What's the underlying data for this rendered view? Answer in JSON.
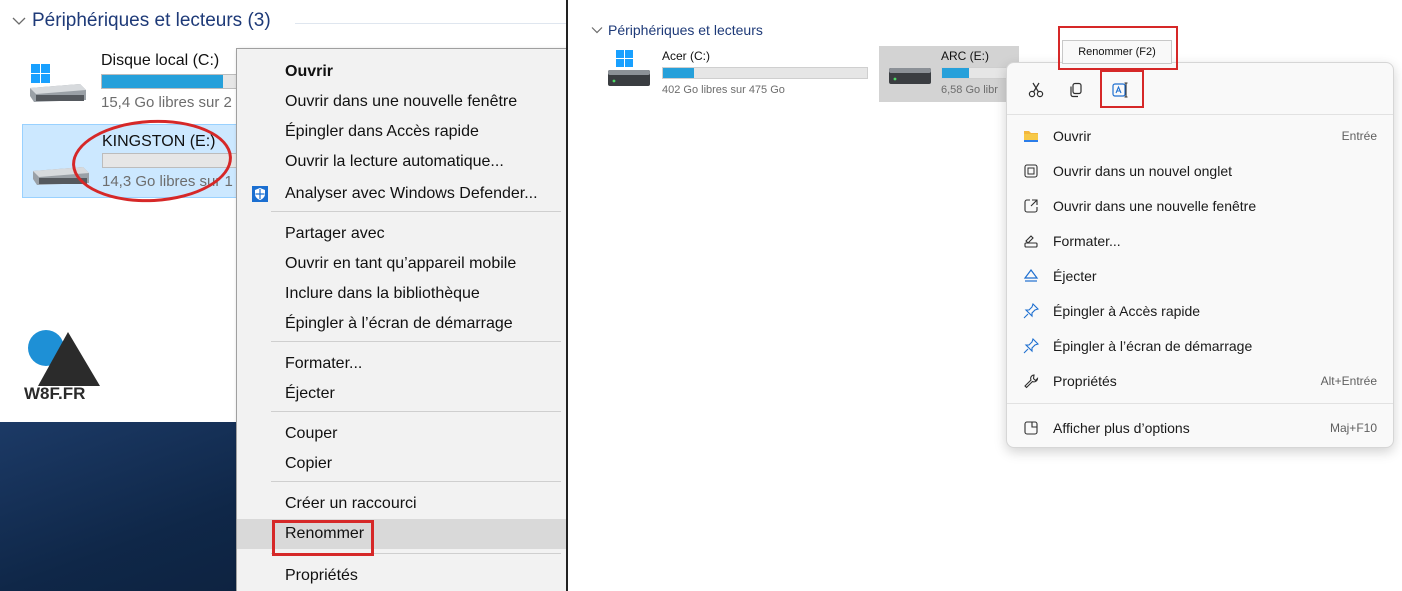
{
  "left": {
    "section_title": "Périphériques et lecteurs (3)",
    "drives": [
      {
        "name": "Disque local (C:)",
        "info": "15,4 Go libres sur 2",
        "usage": 0.58
      },
      {
        "name": "KINGSTON (E:)",
        "info": "14,3 Go libres sur 1",
        "usage": 0.0
      }
    ],
    "logo_text": "W8F.FR",
    "menu": {
      "items": [
        "Ouvrir",
        "Ouvrir dans une nouvelle fenêtre",
        "Épingler dans Accès rapide",
        "Ouvrir la lecture automatique...",
        "Analyser avec Windows Defender...",
        "Partager avec",
        "Ouvrir en tant qu’appareil mobile",
        "Inclure dans la bibliothèque",
        "Épingler à l’écran de démarrage",
        "Formater...",
        "Éjecter",
        "Couper",
        "Copier",
        "Créer un raccourci",
        "Renommer",
        "Propriétés"
      ],
      "highlighted": "Renommer"
    }
  },
  "right": {
    "section_title": "Périphériques et lecteurs",
    "drives": [
      {
        "name": "Acer (C:)",
        "info": "402 Go libres sur 475 Go",
        "usage": 0.15
      },
      {
        "name": "ARC (E:)",
        "info": "6,58 Go libr",
        "usage": 0.35
      }
    ],
    "tooltip": "Renommer (F2)",
    "toolbar_icons": [
      "cut-icon",
      "copy-icon",
      "rename-icon"
    ],
    "menu": {
      "items": [
        {
          "label": "Ouvrir",
          "shortcut": "Entrée",
          "icon": "folder-icon"
        },
        {
          "label": "Ouvrir dans un nouvel onglet",
          "shortcut": "",
          "icon": "new-tab-icon"
        },
        {
          "label": "Ouvrir dans une nouvelle fenêtre",
          "shortcut": "",
          "icon": "new-window-icon"
        },
        {
          "label": "Formater...",
          "shortcut": "",
          "icon": "format-icon"
        },
        {
          "label": "Éjecter",
          "shortcut": "",
          "icon": "eject-icon"
        },
        {
          "label": "Épingler à Accès rapide",
          "shortcut": "",
          "icon": "pin-icon"
        },
        {
          "label": "Épingler à l’écran de démarrage",
          "shortcut": "",
          "icon": "pin-start-icon"
        },
        {
          "label": "Propriétés",
          "shortcut": "Alt+Entrée",
          "icon": "wrench-icon"
        },
        {
          "label": "Afficher plus d’options",
          "shortcut": "Maj+F10",
          "icon": "more-options-icon"
        }
      ]
    }
  },
  "colors": {
    "accent": "#26a0da",
    "highlight_red": "#d62828",
    "selection": "#cce8ff"
  }
}
